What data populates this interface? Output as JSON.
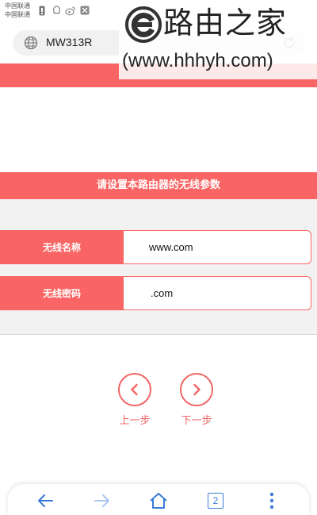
{
  "status_bar": {
    "carrier_1": "中国联通",
    "carrier_2": "中国联通",
    "right_text": "..."
  },
  "address_bar": {
    "url": "MW313R"
  },
  "watermark": {
    "title": "路由之家",
    "url": "(www.hhhyh.com)"
  },
  "panel": {
    "title": "请设置本路由器的无线参数",
    "fields": [
      {
        "label": "无线名称",
        "value": "www.com"
      },
      {
        "label": "无线密码",
        "value": ".com"
      }
    ]
  },
  "nav": {
    "prev_label": "上一步",
    "next_label": "下一步"
  },
  "toolbar": {
    "tab_count": "2"
  },
  "colors": {
    "accent": "#f96564",
    "link_blue": "#3a7bd5"
  }
}
